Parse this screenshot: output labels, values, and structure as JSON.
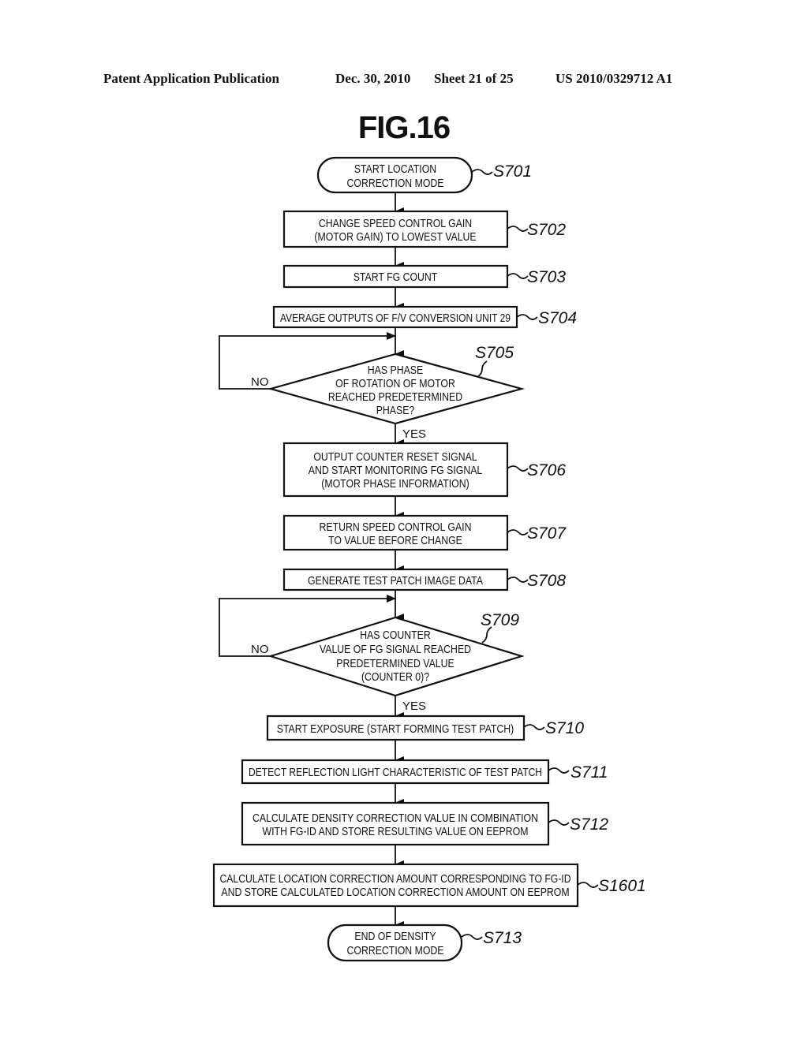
{
  "header": {
    "publication": "Patent Application Publication",
    "date": "Dec. 30, 2010",
    "sheet": "Sheet 21 of 25",
    "number": "US 2010/0329712 A1"
  },
  "figure_title": "FIG.16",
  "steps": {
    "s701": {
      "id": "S701",
      "lines": [
        "START LOCATION",
        "CORRECTION MODE"
      ]
    },
    "s702": {
      "id": "S702",
      "lines": [
        "CHANGE SPEED CONTROL GAIN",
        "(MOTOR GAIN) TO LOWEST VALUE"
      ]
    },
    "s703": {
      "id": "S703",
      "lines": [
        "START FG COUNT"
      ]
    },
    "s704": {
      "id": "S704",
      "lines": [
        "AVERAGE OUTPUTS OF F/V CONVERSION UNIT 29"
      ]
    },
    "s705": {
      "id": "S705",
      "lines": [
        "HAS PHASE",
        "OF ROTATION OF MOTOR",
        "REACHED PREDETERMINED",
        "PHASE?"
      ],
      "no": "NO",
      "yes": "YES"
    },
    "s706": {
      "id": "S706",
      "lines": [
        "OUTPUT COUNTER RESET SIGNAL",
        "AND START MONITORING FG SIGNAL",
        "(MOTOR PHASE INFORMATION)"
      ]
    },
    "s707": {
      "id": "S707",
      "lines": [
        "RETURN SPEED CONTROL GAIN",
        "TO VALUE BEFORE CHANGE"
      ]
    },
    "s708": {
      "id": "S708",
      "lines": [
        "GENERATE TEST PATCH IMAGE DATA"
      ]
    },
    "s709": {
      "id": "S709",
      "lines": [
        "HAS COUNTER",
        "VALUE OF FG SIGNAL REACHED",
        "PREDETERMINED VALUE",
        "(COUNTER 0)?"
      ],
      "no": "NO",
      "yes": "YES"
    },
    "s710": {
      "id": "S710",
      "lines": [
        "START EXPOSURE (START FORMING TEST PATCH)"
      ]
    },
    "s711": {
      "id": "S711",
      "lines": [
        "DETECT REFLECTION LIGHT CHARACTERISTIC OF TEST PATCH"
      ]
    },
    "s712": {
      "id": "S712",
      "lines": [
        "CALCULATE DENSITY CORRECTION VALUE IN COMBINATION",
        "WITH FG-ID AND STORE RESULTING VALUE ON EEPROM"
      ]
    },
    "s1601": {
      "id": "S1601",
      "lines": [
        "CALCULATE LOCATION CORRECTION AMOUNT CORRESPONDING TO FG-ID",
        "AND STORE CALCULATED LOCATION CORRECTION AMOUNT ON EEPROM"
      ]
    },
    "s713": {
      "id": "S713",
      "lines": [
        "END OF DENSITY",
        "CORRECTION MODE"
      ]
    }
  }
}
